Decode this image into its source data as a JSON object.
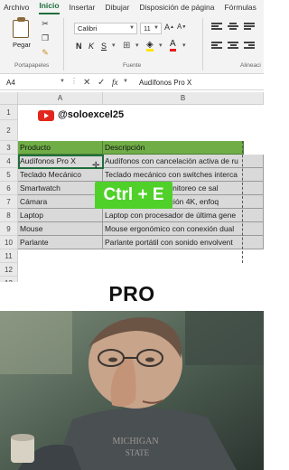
{
  "ribbon": {
    "tabs": [
      "Archivo",
      "Inicio",
      "Insertar",
      "Dibujar",
      "Disposición de página",
      "Fórmulas"
    ],
    "active_tab": "Inicio",
    "paste_label": "Pegar",
    "groups": {
      "clipboard": "Portapapeles",
      "font": "Fuente",
      "alignment": "Alineaci"
    },
    "font_name": "Calibri",
    "font_size": "11"
  },
  "formula_bar": {
    "cell_ref": "A4",
    "fx": "fx",
    "value": "Audífonos Pro X"
  },
  "sheet": {
    "columns": [
      "A",
      "B"
    ],
    "rows": [
      "1",
      "2",
      "3",
      "4",
      "5",
      "6",
      "7",
      "8",
      "9",
      "10",
      "11",
      "12",
      "13",
      "14"
    ],
    "channel": "@soloexcel25",
    "table_headers": [
      "Producto",
      "Descripción"
    ],
    "table_rows": [
      [
        "Audífonos Pro X",
        "Audífonos con cancelación activa de ru"
      ],
      [
        "Teclado Mecánico",
        "Teclado mecánico con switches interca"
      ],
      [
        "Smartwatch",
        "Smartwatch con monitoreo ce sal"
      ],
      [
        "Cámara",
        "Cámara con resolución 4K, enfoq"
      ],
      [
        "Laptop",
        "Laptop con procesador de última gene"
      ],
      [
        "Mouse",
        "Mouse ergonómico con conexión dual"
      ],
      [
        "Parlante",
        "Parlante portátil con sonido envolvent"
      ]
    ]
  },
  "overlay": {
    "shortcut": "Ctrl + E",
    "caption": "PRO"
  },
  "colors": {
    "header_green": "#70ad47",
    "shortcut_green": "#4fd12a",
    "excel_green": "#1e6e3c"
  }
}
